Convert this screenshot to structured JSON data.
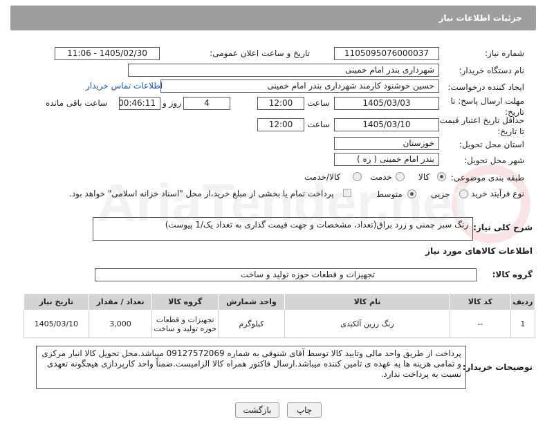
{
  "header": {
    "title": "جزئیات اطلاعات نیاز"
  },
  "need_number": {
    "label": "شماره نیاز:",
    "value": "1105095076000037"
  },
  "announce_date": {
    "label": "تاریخ و ساعت اعلان عمومی:",
    "value": "1405/02/30 - 11:06"
  },
  "buyer_org": {
    "label": "نام دستگاه خریدار:",
    "value": "شهرداری بندر امام خمینی"
  },
  "requester": {
    "label": "ایجاد کننده درخواست:",
    "value": "حسین خوشنود کارمند شهرداری بندر امام خمینی",
    "contact_link": "اطلاعات تماس خریدار"
  },
  "deadline": {
    "label": "مهلت ارسال پاسخ: تا تاریخ:",
    "date": "1405/03/03",
    "time_label": "ساعت",
    "time": "12:00",
    "days": "4",
    "days_label": "روز و",
    "remaining": "00:46:11",
    "remaining_label": "ساعت باقی مانده"
  },
  "validity": {
    "label": "حداقل تاریخ اعتبار قیمت: تا تاریخ:",
    "date": "1405/03/10",
    "time_label": "ساعت",
    "time": "12:00"
  },
  "province": {
    "label": "استان محل تحویل:",
    "value": "خوزستان"
  },
  "city": {
    "label": "شهر محل تحویل:",
    "value": "بندر امام خمینی ( ره )"
  },
  "category": {
    "label": "طبقه بندی موضوعی:",
    "options": [
      "کالا",
      "خدمت",
      "کالا/خدمت"
    ],
    "selected": "کالا"
  },
  "purchase_type": {
    "label": "نوع فرآیند خرید :",
    "options": [
      "جزیی",
      "متوسط"
    ],
    "selected": "متوسط",
    "note": "پرداخت تمام یا بخشی از مبلغ خرید،از محل \"اسناد خزانه اسلامی\" خواهد بود."
  },
  "description": {
    "label": "شرح کلی نیاز:",
    "value": "رنگ سبز چمنی و زرد براق(تعداد، مشخصات و جهت قیمت گذاری به تعداد یک/1 پیوست)"
  },
  "goods_section": {
    "title": "اطلاعات کالاهای مورد نیاز"
  },
  "goods_group": {
    "label": "گروه کالا:",
    "value": "تجهیزات و قطعات حوزه تولید و ساخت"
  },
  "goods_table": {
    "headers": [
      "ردیف",
      "کد کالا",
      "نام کالا",
      "واحد شمارش",
      "گروه کالا",
      "تعداد / مقدار",
      "تاریخ نیاز"
    ],
    "rows": [
      [
        "1",
        "--",
        "رنگ رزین آلکیدی",
        "کیلوگرم",
        "تجهیزات و قطعات حوزه تولید و ساخت",
        "3,000",
        "1405/03/10"
      ]
    ]
  },
  "buyer_notes": {
    "label": "توضیحات خریدار:",
    "value": "پرداخت از طریق واحد مالی وتایید کالا توسط آقای شنوقی به شماره  09127572069 میباشد.محل تحویل کالا انبار مرکزی و تمامی هزینه ها به عهده ی تامین کننده میباشد.ارسال فاکتور همراه کالا الزامیست.ضمناً واحد کارپردازی هیچگونه تعهدی نسبت به پرداخت ندارد."
  },
  "buttons": {
    "print": "چاپ",
    "back": "بازگشت"
  },
  "watermark": {
    "text": "AriaTender.net"
  },
  "colors": {
    "header_bg": "#9e9e9e",
    "link": "#1a56b0",
    "table_header": "#d4d4d4"
  }
}
